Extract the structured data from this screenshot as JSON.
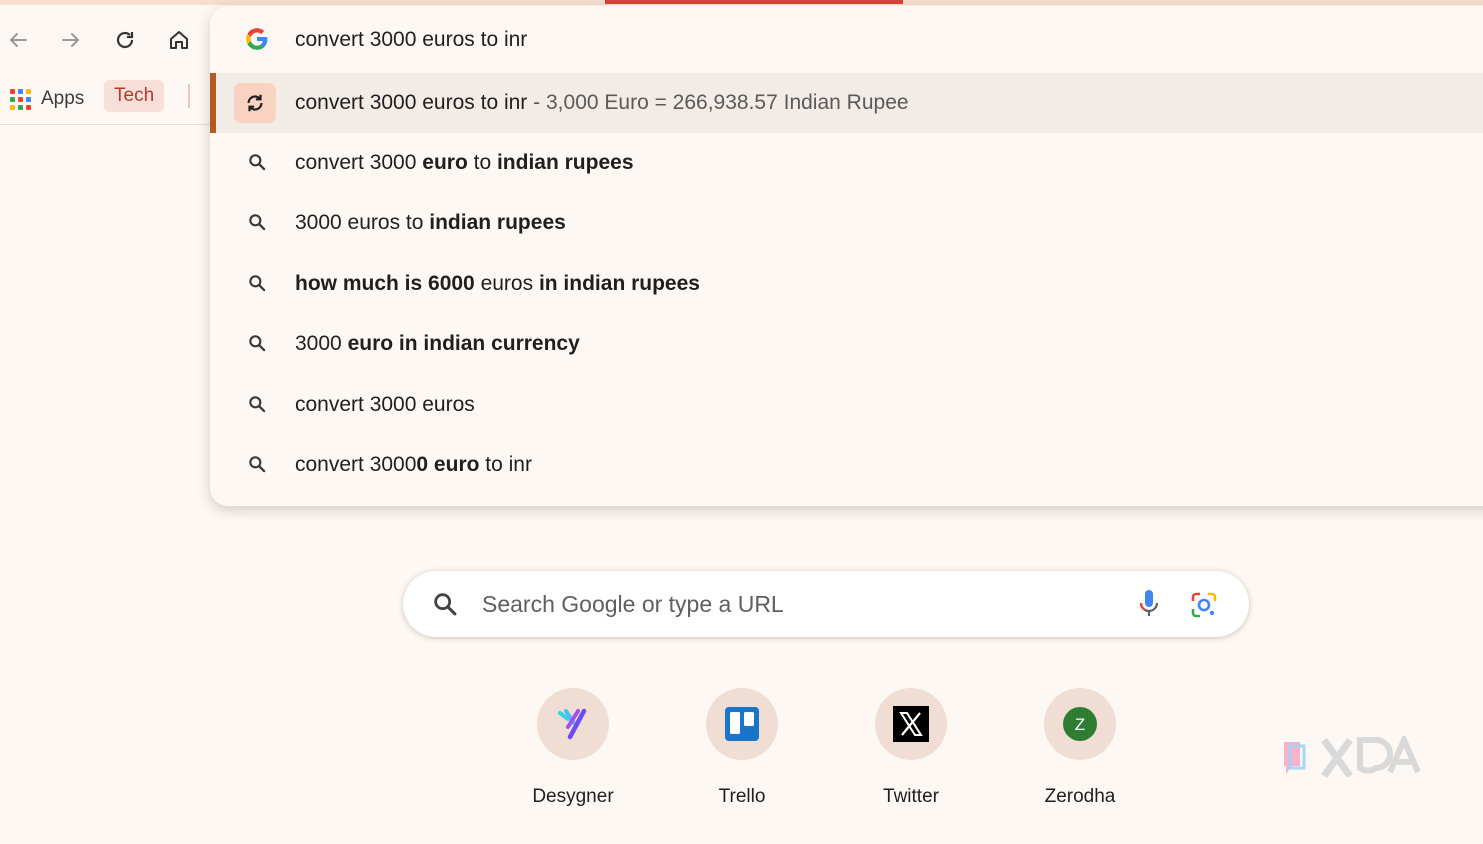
{
  "toolbar": {
    "back_icon": "arrow-left-icon",
    "forward_icon": "arrow-right-icon",
    "reload_icon": "reload-icon",
    "home_icon": "home-icon"
  },
  "bookmarks": {
    "apps_label": "Apps",
    "tech_label": "Tech"
  },
  "omnibox_dropdown": {
    "query": "convert 3000 euros to inr",
    "selected": {
      "query": "convert 3000 euros to inr",
      "separator": "-",
      "answer": "3,000 Euro = 266,938.57 Indian Rupee"
    },
    "suggestions": [
      {
        "parts": [
          {
            "t": "convert 3000 ",
            "b": false
          },
          {
            "t": "euro",
            "b": true
          },
          {
            "t": " to ",
            "b": false
          },
          {
            "t": "indian rupees",
            "b": true
          }
        ]
      },
      {
        "parts": [
          {
            "t": "3000 euros to ",
            "b": false
          },
          {
            "t": "indian rupees",
            "b": true
          }
        ]
      },
      {
        "parts": [
          {
            "t": "how much is 6000",
            "b": true
          },
          {
            "t": " euros ",
            "b": false
          },
          {
            "t": "in indian rupees",
            "b": true
          }
        ]
      },
      {
        "parts": [
          {
            "t": "3000 ",
            "b": false
          },
          {
            "t": "euro in indian currency",
            "b": true
          }
        ]
      },
      {
        "parts": [
          {
            "t": "convert 3000 euros",
            "b": false
          }
        ]
      },
      {
        "parts": [
          {
            "t": "convert 3000",
            "b": false
          },
          {
            "t": "0 euro",
            "b": true
          },
          {
            "t": " to inr",
            "b": false
          }
        ]
      }
    ]
  },
  "search": {
    "placeholder": "Search Google or type a URL"
  },
  "shortcuts": [
    {
      "label": "Desygner"
    },
    {
      "label": "Trello"
    },
    {
      "label": "Twitter"
    },
    {
      "label": "Zerodha",
      "icon_letter": "Z"
    }
  ],
  "colors": {
    "background": "#fdf8f3",
    "selected_row": "#f2ebe6",
    "accent": "#b35a1f",
    "load_bar": "#d6453a"
  }
}
